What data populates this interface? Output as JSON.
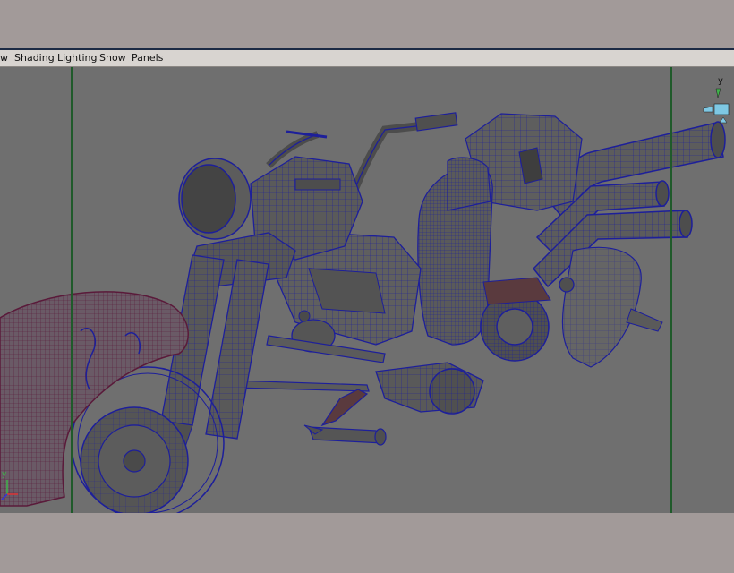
{
  "menubar": {
    "items": [
      {
        "label": "w"
      },
      {
        "label": "Shading"
      },
      {
        "label": "Lighting"
      },
      {
        "label": "Show"
      },
      {
        "label": "Panels"
      }
    ]
  },
  "viewport": {
    "background": "#6f6f6f",
    "wire_color": "#1d1f9a",
    "gate_color": "#1f5a2a",
    "axis_gizmo": {
      "y": "y",
      "x": "x"
    }
  },
  "view_cube": {
    "label": "y",
    "color": "#7ec8e3"
  }
}
